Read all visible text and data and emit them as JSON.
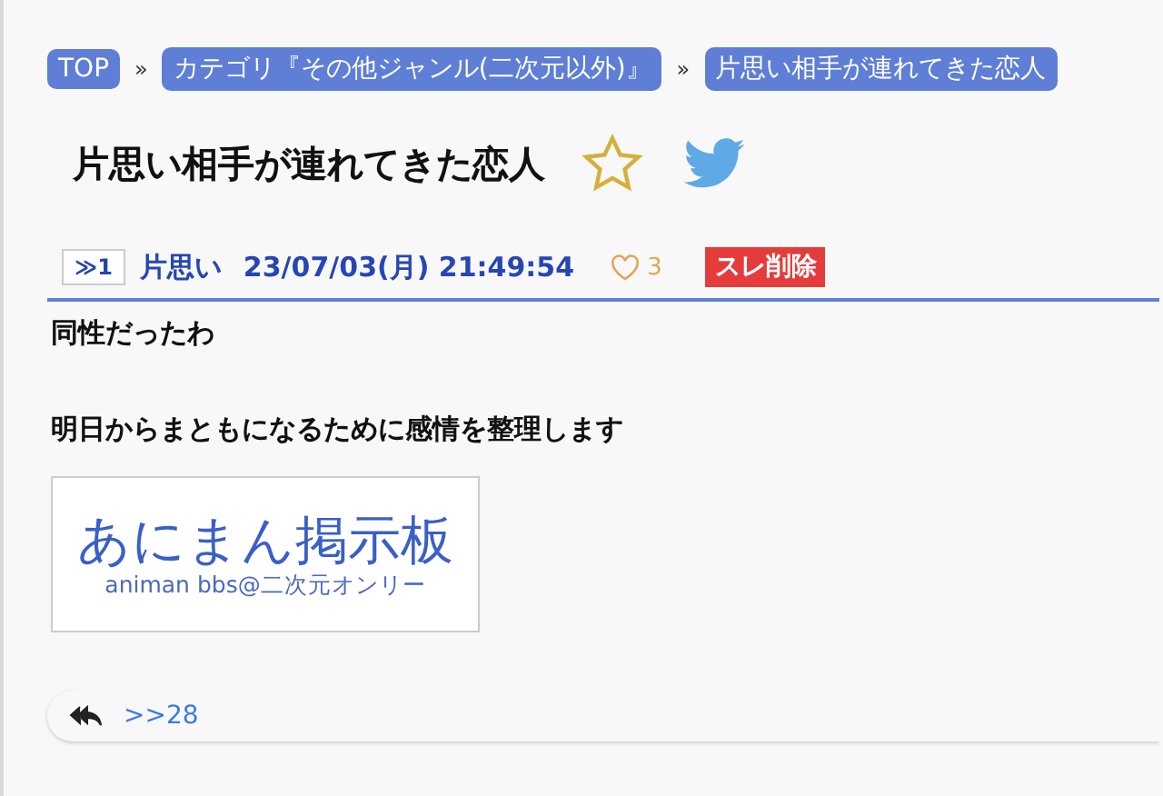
{
  "breadcrumbs": [
    {
      "label": "TOP"
    },
    {
      "label": "カテゴリ『その他ジャンル(二次元以外)』"
    },
    {
      "label": "片思い相手が連れてきた恋人"
    }
  ],
  "breadcrumb_separator": "»",
  "thread": {
    "title": "片思い相手が連れてきた恋人",
    "favorited": false
  },
  "post": {
    "number": "≫1",
    "author": "片思い",
    "datetime": "23/07/03(月) 21:49:54",
    "likes": "3",
    "delete_button": "スレ削除",
    "lines": [
      "同性だったわ",
      "明日からまともになるために感情を整理します"
    ],
    "image": {
      "title": "あにまん掲示板",
      "subtitle": "animan bbs@二次元オンリー"
    },
    "replies": [
      {
        "label": ">>28"
      }
    ]
  }
}
